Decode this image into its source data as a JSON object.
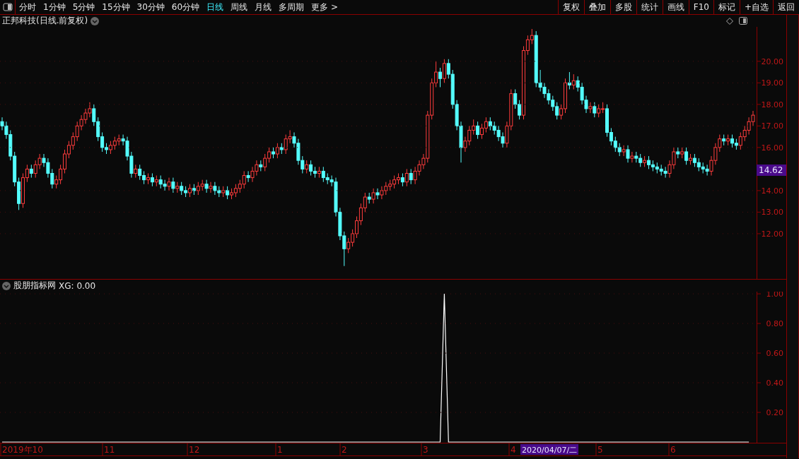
{
  "toolbar": {
    "periods": [
      {
        "label": "分时",
        "selected": false
      },
      {
        "label": "1分钟",
        "selected": false
      },
      {
        "label": "5分钟",
        "selected": false
      },
      {
        "label": "15分钟",
        "selected": false
      },
      {
        "label": "30分钟",
        "selected": false
      },
      {
        "label": "60分钟",
        "selected": false
      },
      {
        "label": "日线",
        "selected": true
      },
      {
        "label": "周线",
        "selected": false
      },
      {
        "label": "月线",
        "selected": false
      },
      {
        "label": "多周期",
        "selected": false
      }
    ],
    "more": "更多",
    "more_arrow": ">",
    "actions": [
      "复权",
      "叠加",
      "多股",
      "统计",
      "画线",
      "F10",
      "标记",
      "+自选",
      "返回"
    ]
  },
  "price_panel": {
    "title": "正邦科技(日线.前复权)",
    "current_price": "14.62",
    "chart_data": {
      "type": "candlestick",
      "grid": true,
      "ylim": [
        9.9,
        21.6
      ],
      "yticks": [
        {
          "value": 20,
          "label": "20.00"
        },
        {
          "value": 19,
          "label": "19.00"
        },
        {
          "value": 18,
          "label": "18.00"
        },
        {
          "value": 17,
          "label": "17.00"
        },
        {
          "value": 16,
          "label": "16.00"
        },
        {
          "value": 14,
          "label": "14.00"
        },
        {
          "value": 13,
          "label": "13.00"
        },
        {
          "value": 12,
          "label": "12.00"
        }
      ],
      "ohlc": [
        [
          17.2,
          17.4,
          16.8,
          17.0
        ],
        [
          17.0,
          17.2,
          16.4,
          16.6
        ],
        [
          16.6,
          16.8,
          15.4,
          15.6
        ],
        [
          15.6,
          15.8,
          14.2,
          14.4
        ],
        [
          14.4,
          14.6,
          13.1,
          13.4
        ],
        [
          13.4,
          14.8,
          13.2,
          14.6
        ],
        [
          14.6,
          15.2,
          14.4,
          15.0
        ],
        [
          15.0,
          15.2,
          14.6,
          14.8
        ],
        [
          14.8,
          15.4,
          14.6,
          15.2
        ],
        [
          15.2,
          15.7,
          15.0,
          15.5
        ],
        [
          15.5,
          15.7,
          15.1,
          15.3
        ],
        [
          15.3,
          15.5,
          14.6,
          14.8
        ],
        [
          14.8,
          15.0,
          14.1,
          14.3
        ],
        [
          14.3,
          14.7,
          14.1,
          14.5
        ],
        [
          14.5,
          15.2,
          14.3,
          15.0
        ],
        [
          15.0,
          15.9,
          14.8,
          15.7
        ],
        [
          15.7,
          16.3,
          15.5,
          16.1
        ],
        [
          16.1,
          16.7,
          15.9,
          16.5
        ],
        [
          16.5,
          17.2,
          16.3,
          17.0
        ],
        [
          17.0,
          17.5,
          16.8,
          17.3
        ],
        [
          17.3,
          17.8,
          17.1,
          17.6
        ],
        [
          17.6,
          18.1,
          17.4,
          17.8
        ],
        [
          17.8,
          18.0,
          17.0,
          17.2
        ],
        [
          17.2,
          17.4,
          16.3,
          16.5
        ],
        [
          16.5,
          16.7,
          15.8,
          16.0
        ],
        [
          16.0,
          16.2,
          15.7,
          15.9
        ],
        [
          15.9,
          16.3,
          15.7,
          16.1
        ],
        [
          16.1,
          16.5,
          15.9,
          16.3
        ],
        [
          16.3,
          16.6,
          16.1,
          16.4
        ],
        [
          16.4,
          16.6,
          16.1,
          16.3
        ],
        [
          16.3,
          16.5,
          15.4,
          15.6
        ],
        [
          15.6,
          15.8,
          14.6,
          14.8
        ],
        [
          14.8,
          15.2,
          14.6,
          15.0
        ],
        [
          15.0,
          15.2,
          14.5,
          14.7
        ],
        [
          14.7,
          14.9,
          14.3,
          14.5
        ],
        [
          14.5,
          14.8,
          14.3,
          14.6
        ],
        [
          14.6,
          14.8,
          14.2,
          14.4
        ],
        [
          14.4,
          14.7,
          14.2,
          14.5
        ],
        [
          14.5,
          14.7,
          14.1,
          14.3
        ],
        [
          14.3,
          14.5,
          14.0,
          14.2
        ],
        [
          14.2,
          14.6,
          14.0,
          14.4
        ],
        [
          14.4,
          14.6,
          13.9,
          14.1
        ],
        [
          14.1,
          14.4,
          13.9,
          14.2
        ],
        [
          14.2,
          14.4,
          13.8,
          14.0
        ],
        [
          14.0,
          14.2,
          13.7,
          13.9
        ],
        [
          13.9,
          14.3,
          13.7,
          14.1
        ],
        [
          14.1,
          14.3,
          13.8,
          14.0
        ],
        [
          14.0,
          14.4,
          13.8,
          14.2
        ],
        [
          14.2,
          14.5,
          14.0,
          14.3
        ],
        [
          14.3,
          14.5,
          13.9,
          14.1
        ],
        [
          14.1,
          14.4,
          13.9,
          14.2
        ],
        [
          14.2,
          14.4,
          13.8,
          14.0
        ],
        [
          14.0,
          14.2,
          13.7,
          13.9
        ],
        [
          13.9,
          14.2,
          13.7,
          14.0
        ],
        [
          14.0,
          14.2,
          13.6,
          13.8
        ],
        [
          13.8,
          14.1,
          13.6,
          13.9
        ],
        [
          13.9,
          14.3,
          13.7,
          14.1
        ],
        [
          14.1,
          14.5,
          13.9,
          14.3
        ],
        [
          14.3,
          14.9,
          14.1,
          14.7
        ],
        [
          14.7,
          14.9,
          14.4,
          14.6
        ],
        [
          14.6,
          15.1,
          14.4,
          14.9
        ],
        [
          14.9,
          15.4,
          14.7,
          15.2
        ],
        [
          15.2,
          15.4,
          14.9,
          15.1
        ],
        [
          15.1,
          15.7,
          14.9,
          15.5
        ],
        [
          15.5,
          16.0,
          15.3,
          15.8
        ],
        [
          15.8,
          16.0,
          15.5,
          15.7
        ],
        [
          15.7,
          16.2,
          15.5,
          16.0
        ],
        [
          16.0,
          16.2,
          15.7,
          15.9
        ],
        [
          15.9,
          16.6,
          15.7,
          16.4
        ],
        [
          16.4,
          16.8,
          16.2,
          16.5
        ],
        [
          16.5,
          16.7,
          16.0,
          16.2
        ],
        [
          16.2,
          16.4,
          15.2,
          15.4
        ],
        [
          15.4,
          15.6,
          14.8,
          15.0
        ],
        [
          15.0,
          15.4,
          14.8,
          15.2
        ],
        [
          15.2,
          15.4,
          14.7,
          14.9
        ],
        [
          14.9,
          15.1,
          14.6,
          14.8
        ],
        [
          14.8,
          15.1,
          14.6,
          14.9
        ],
        [
          14.9,
          15.1,
          14.4,
          14.6
        ],
        [
          14.6,
          14.8,
          14.3,
          14.5
        ],
        [
          14.5,
          14.7,
          14.2,
          14.4
        ],
        [
          14.4,
          14.6,
          12.8,
          13.0
        ],
        [
          13.0,
          13.2,
          11.7,
          11.9
        ],
        [
          11.9,
          12.1,
          10.5,
          11.3
        ],
        [
          11.3,
          11.8,
          11.1,
          11.6
        ],
        [
          11.6,
          12.2,
          11.4,
          12.0
        ],
        [
          12.0,
          12.8,
          11.8,
          12.6
        ],
        [
          12.6,
          13.4,
          12.4,
          13.2
        ],
        [
          13.2,
          13.9,
          13.0,
          13.7
        ],
        [
          13.7,
          13.9,
          13.4,
          13.6
        ],
        [
          13.6,
          14.1,
          13.4,
          13.9
        ],
        [
          13.9,
          14.1,
          13.6,
          13.8
        ],
        [
          13.8,
          14.2,
          13.6,
          14.0
        ],
        [
          14.0,
          14.4,
          13.8,
          14.2
        ],
        [
          14.2,
          14.5,
          14.0,
          14.3
        ],
        [
          14.3,
          14.7,
          14.1,
          14.5
        ],
        [
          14.5,
          14.8,
          14.3,
          14.6
        ],
        [
          14.6,
          14.8,
          14.2,
          14.4
        ],
        [
          14.4,
          15.0,
          14.2,
          14.8
        ],
        [
          14.8,
          15.0,
          14.3,
          14.5
        ],
        [
          14.5,
          15.1,
          14.3,
          14.9
        ],
        [
          14.9,
          15.4,
          14.7,
          15.2
        ],
        [
          15.2,
          15.7,
          15.0,
          15.5
        ],
        [
          15.5,
          17.7,
          15.3,
          17.5
        ],
        [
          17.5,
          19.2,
          17.3,
          19.0
        ],
        [
          19.0,
          20.0,
          18.8,
          19.5
        ],
        [
          19.5,
          19.7,
          18.8,
          19.2
        ],
        [
          19.2,
          20.1,
          19.0,
          19.9
        ],
        [
          19.9,
          20.1,
          19.2,
          19.4
        ],
        [
          19.4,
          19.6,
          17.8,
          18.0
        ],
        [
          18.0,
          18.2,
          16.8,
          17.0
        ],
        [
          17.0,
          17.2,
          15.3,
          16.0
        ],
        [
          16.0,
          16.5,
          15.8,
          16.3
        ],
        [
          16.3,
          17.0,
          16.1,
          16.8
        ],
        [
          16.8,
          17.3,
          16.6,
          17.0
        ],
        [
          17.0,
          17.2,
          16.4,
          16.6
        ],
        [
          16.6,
          17.1,
          16.4,
          16.9
        ],
        [
          16.9,
          17.4,
          16.7,
          17.2
        ],
        [
          17.2,
          17.4,
          16.8,
          17.0
        ],
        [
          17.0,
          17.2,
          16.6,
          16.8
        ],
        [
          16.8,
          17.0,
          16.3,
          16.5
        ],
        [
          16.5,
          16.7,
          16.0,
          16.2
        ],
        [
          16.2,
          17.2,
          16.0,
          17.0
        ],
        [
          17.0,
          18.7,
          16.8,
          18.5
        ],
        [
          18.5,
          18.7,
          17.8,
          18.0
        ],
        [
          18.0,
          18.2,
          17.3,
          17.5
        ],
        [
          17.5,
          20.7,
          17.3,
          20.5
        ],
        [
          20.5,
          21.2,
          20.3,
          21.0
        ],
        [
          21.0,
          21.5,
          20.8,
          21.2
        ],
        [
          21.2,
          21.4,
          18.8,
          19.0
        ],
        [
          19.0,
          19.6,
          18.6,
          18.8
        ],
        [
          18.8,
          19.0,
          18.3,
          18.5
        ],
        [
          18.5,
          18.7,
          18.0,
          18.2
        ],
        [
          18.2,
          18.4,
          17.7,
          17.9
        ],
        [
          17.9,
          18.1,
          17.3,
          17.5
        ],
        [
          17.5,
          18.0,
          17.3,
          17.8
        ],
        [
          17.8,
          19.2,
          17.6,
          19.0
        ],
        [
          19.0,
          19.5,
          18.7,
          18.9
        ],
        [
          18.9,
          19.4,
          18.7,
          19.1
        ],
        [
          19.1,
          19.3,
          18.6,
          18.8
        ],
        [
          18.8,
          19.0,
          18.0,
          18.2
        ],
        [
          18.2,
          18.4,
          17.6,
          17.8
        ],
        [
          17.8,
          18.1,
          17.6,
          17.9
        ],
        [
          17.9,
          18.1,
          17.4,
          17.6
        ],
        [
          17.6,
          18.0,
          17.4,
          17.8
        ],
        [
          17.8,
          18.1,
          17.6,
          17.8
        ],
        [
          17.8,
          18.0,
          16.5,
          16.7
        ],
        [
          16.7,
          16.9,
          16.1,
          16.3
        ],
        [
          16.3,
          16.5,
          15.8,
          16.0
        ],
        [
          16.0,
          16.2,
          15.6,
          15.8
        ],
        [
          15.8,
          16.1,
          15.6,
          15.9
        ],
        [
          15.9,
          16.1,
          15.3,
          15.5
        ],
        [
          15.5,
          15.8,
          15.3,
          15.6
        ],
        [
          15.6,
          15.8,
          15.3,
          15.5
        ],
        [
          15.5,
          15.7,
          15.1,
          15.3
        ],
        [
          15.3,
          15.6,
          15.1,
          15.4
        ],
        [
          15.4,
          15.6,
          15.0,
          15.2
        ],
        [
          15.2,
          15.4,
          14.9,
          15.1
        ],
        [
          15.1,
          15.3,
          14.8,
          15.0
        ],
        [
          15.0,
          15.2,
          14.7,
          14.9
        ],
        [
          14.9,
          15.1,
          14.6,
          14.8
        ],
        [
          14.8,
          15.4,
          14.6,
          15.2
        ],
        [
          15.2,
          16.0,
          15.0,
          15.8
        ],
        [
          15.8,
          16.0,
          15.5,
          15.7
        ],
        [
          15.7,
          16.0,
          15.5,
          15.8
        ],
        [
          15.8,
          16.0,
          15.2,
          15.4
        ],
        [
          15.4,
          15.7,
          15.2,
          15.5
        ],
        [
          15.5,
          15.7,
          15.1,
          15.3
        ],
        [
          15.3,
          15.5,
          14.9,
          15.1
        ],
        [
          15.1,
          15.3,
          14.8,
          15.0
        ],
        [
          15.0,
          15.2,
          14.7,
          14.9
        ],
        [
          14.9,
          15.6,
          14.7,
          15.4
        ],
        [
          15.4,
          16.2,
          15.2,
          16.0
        ],
        [
          16.0,
          16.6,
          15.8,
          16.4
        ],
        [
          16.4,
          16.6,
          16.1,
          16.3
        ],
        [
          16.3,
          16.6,
          16.1,
          16.4
        ],
        [
          16.4,
          16.6,
          16.0,
          16.2
        ],
        [
          16.2,
          16.4,
          15.9,
          16.1
        ],
        [
          16.1,
          16.7,
          15.9,
          16.5
        ],
        [
          16.5,
          17.0,
          16.3,
          16.8
        ],
        [
          16.8,
          17.4,
          16.6,
          17.2
        ],
        [
          17.2,
          17.7,
          17.0,
          17.5
        ]
      ]
    }
  },
  "indicator_panel": {
    "name": "股朋指标网",
    "reading": "XG: 0.00",
    "chart_data": {
      "type": "line",
      "grid": true,
      "series": [
        {
          "color": "#ffffff",
          "values": [
            0,
            0,
            0,
            0,
            0,
            0,
            0,
            0,
            0,
            0,
            0,
            0,
            0,
            0,
            0,
            0,
            0,
            0,
            0,
            0,
            0,
            0,
            0,
            0,
            0,
            0,
            0,
            0,
            0,
            0,
            0,
            0,
            0,
            0,
            0,
            0,
            0,
            0,
            0,
            0,
            0,
            0,
            0,
            0,
            0,
            0,
            0,
            0,
            0,
            0,
            0,
            0,
            0,
            0,
            0,
            0,
            0,
            0,
            0,
            0,
            0,
            0,
            0,
            0,
            0,
            0,
            0,
            0,
            0,
            0,
            0,
            0,
            0,
            0,
            0,
            0,
            0,
            0,
            0,
            0,
            0,
            0,
            0,
            0,
            0,
            0,
            0,
            0,
            0,
            0,
            0,
            0,
            0,
            0,
            0,
            0,
            0,
            0,
            0,
            0,
            0,
            0,
            0,
            0,
            0,
            0,
            1,
            0,
            0,
            0,
            0,
            0,
            0,
            0,
            0,
            0,
            0,
            0,
            0,
            0,
            0,
            0,
            0,
            0,
            0,
            0,
            0,
            0,
            0,
            0,
            0,
            0,
            0,
            0,
            0,
            0,
            0,
            0,
            0,
            0,
            0,
            0,
            0,
            0,
            0,
            0,
            0,
            0,
            0,
            0,
            0,
            0,
            0,
            0,
            0,
            0,
            0,
            0,
            0,
            0,
            0,
            0,
            0,
            0,
            0,
            0,
            0,
            0,
            0,
            0,
            0,
            0,
            0,
            0,
            0,
            0,
            0,
            0,
            0,
            0
          ]
        }
      ],
      "ylim": [
        0,
        1.01
      ],
      "yticks": [
        {
          "value": 0.2,
          "label": "0.20"
        },
        {
          "value": 0.4,
          "label": "0.40"
        },
        {
          "value": 0.6,
          "label": "0.60"
        },
        {
          "value": 0.8,
          "label": "0.80"
        },
        {
          "value": 1.0,
          "label": "1.00"
        }
      ]
    }
  },
  "time_axis": {
    "labels": [
      "2019年10",
      "11",
      "12",
      "1",
      "2",
      "3",
      "4",
      "5",
      "6"
    ],
    "cursor_date": "2020/04/07/二"
  }
}
